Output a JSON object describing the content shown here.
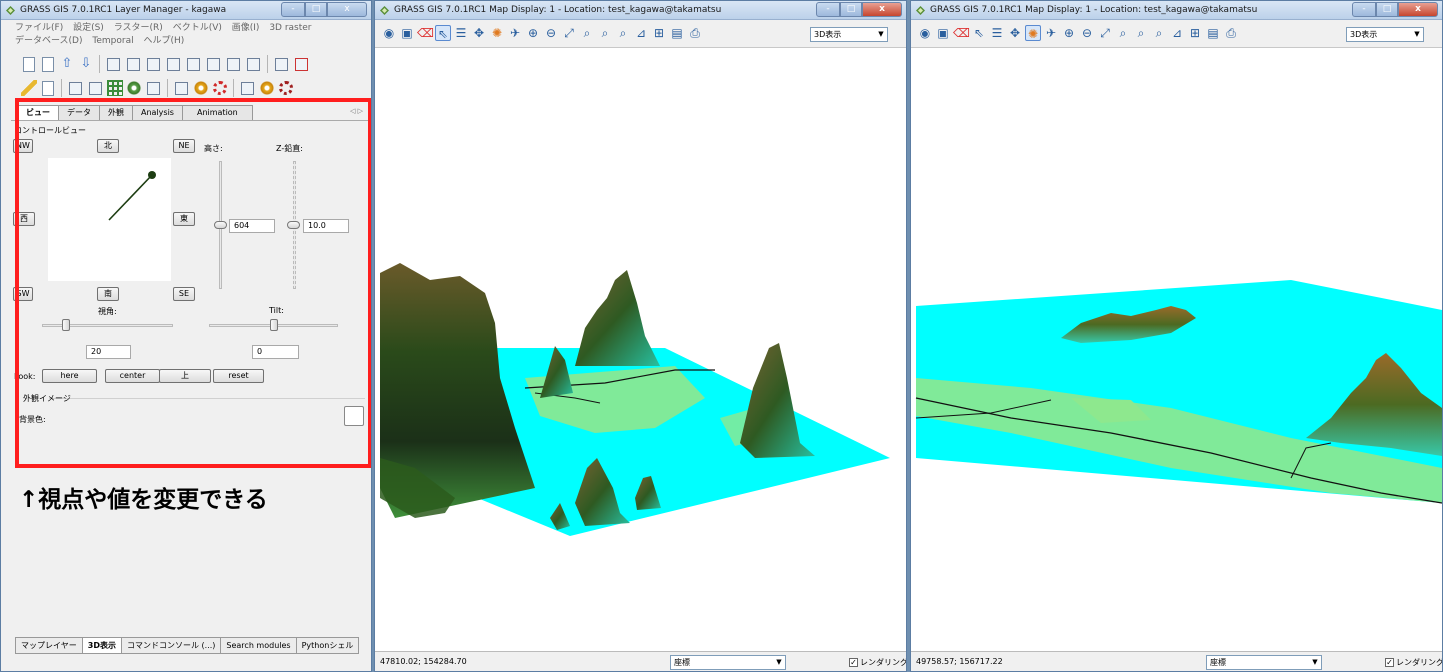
{
  "layer_manager": {
    "title": "GRASS GIS 7.0.1RC1 Layer Manager - kagawa",
    "window_buttons": [
      "-",
      "□",
      "x"
    ],
    "menu": [
      "ファイル(F)",
      "設定(S)",
      "ラスター(R)",
      "ベクトル(V)",
      "画像(I)",
      "3D raster",
      "データベース(D)",
      "Temporal",
      "ヘルプ(H)"
    ],
    "tabs": [
      "ビュー",
      "データ",
      "外観",
      "Analysis",
      "Animation"
    ],
    "control_view_label": "コントロールビュー",
    "dir_buttons": {
      "nw": "NW",
      "n": "北",
      "ne": "NE",
      "w": "西",
      "e": "東",
      "sw": "SW",
      "s": "南",
      "se": "SE"
    },
    "height_label": "高さ:",
    "height_value": "604",
    "zexag_label": "Z-鉛直:",
    "zexag_value": "10.0",
    "fov_label": "視角:",
    "fov_value": "20",
    "tilt_label": "Tilt:",
    "tilt_value": "0",
    "look_label": "Look:",
    "look_buttons": [
      "here",
      "center",
      "上",
      "reset"
    ],
    "appearance_section": "外観イメージ",
    "bg_color_label": "背景色:",
    "annotation": "↑視点や値を変更できる",
    "bottom_tabs": [
      "マップレイヤー",
      "3D表示",
      "コマンドコンソール (...)",
      "Search modules",
      "Pythonシェル"
    ],
    "active_bottom_tab": "3D表示"
  },
  "map_display_1": {
    "title": "GRASS GIS 7.0.1RC1 Map Display: 1  - Location: test_kagawa@takamatsu",
    "window_buttons": [
      "-",
      "□",
      "x"
    ],
    "render_mode": "3D表示",
    "coordinates": "47810.02; 154284.70",
    "status_mode": "座標",
    "render_checkbox_label": "レンダリング",
    "render_checked": true
  },
  "map_display_2": {
    "title": "GRASS GIS 7.0.1RC1 Map Display: 1  - Location: test_kagawa@takamatsu",
    "window_buttons": [
      "-",
      "□",
      "x"
    ],
    "render_mode": "3D表示",
    "coordinates": "49758.57; 156717.22",
    "status_mode": "座標",
    "render_checkbox_label": "レンダリング",
    "render_checked": true
  },
  "colors": {
    "water": "#00ffff",
    "lowland": "#8ee88e",
    "highlight_frame": "#ff1e1e"
  }
}
